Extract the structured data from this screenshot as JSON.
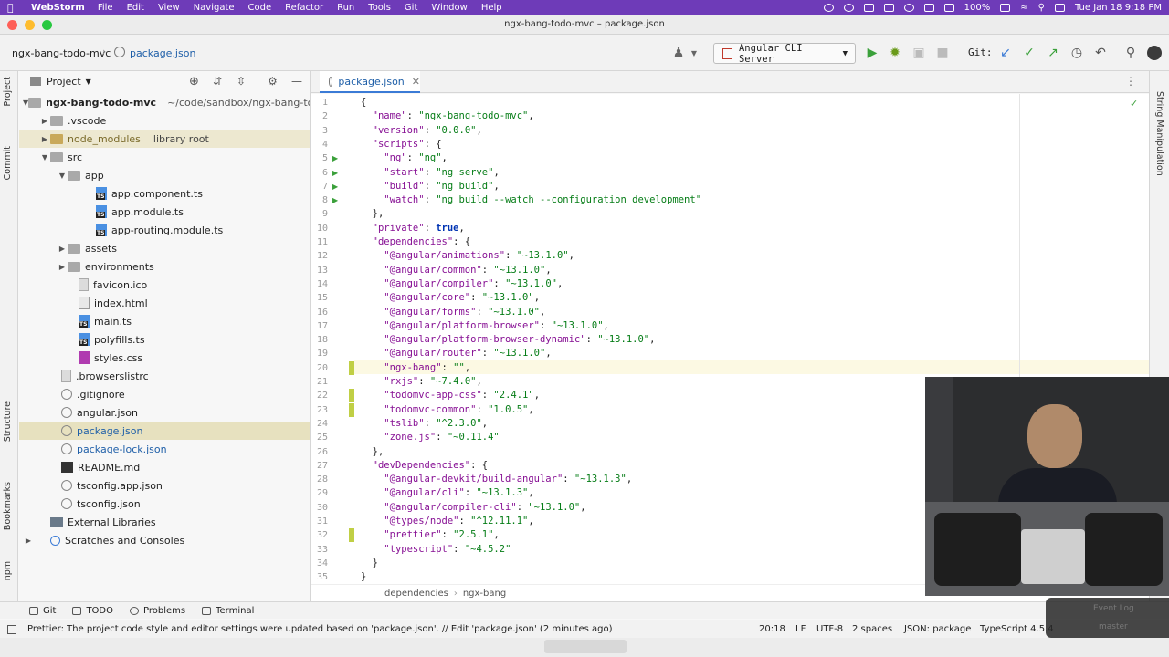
{
  "menubar": {
    "app": "WebStorm",
    "items": [
      "File",
      "Edit",
      "View",
      "Navigate",
      "Code",
      "Refactor",
      "Run",
      "Tools",
      "Git",
      "Window",
      "Help"
    ],
    "battery": "100%",
    "datetime": "Tue Jan 18  9:18 PM"
  },
  "window": {
    "title": "ngx-bang-todo-mvc – package.json"
  },
  "navbar": {
    "crumb_project": "ngx-bang-todo-mvc",
    "crumb_file": "package.json",
    "run_config": "Angular CLI Server",
    "git_label": "Git:"
  },
  "strip": {
    "project": "Project",
    "commit": "Commit",
    "structure": "Structure",
    "bookmarks": "Bookmarks",
    "npm": "npm",
    "string_manipulation": "String Manipulation"
  },
  "project_panel": {
    "title": "Project",
    "items": [
      {
        "label": "ngx-bang-todo-mvc",
        "extra": "~/code/sandbox/ngx-bang-todo"
      },
      {
        "label": ".vscode"
      },
      {
        "label": "node_modules",
        "extra": "library root"
      },
      {
        "label": "src"
      },
      {
        "label": "app"
      },
      {
        "label": "app.component.ts"
      },
      {
        "label": "app.module.ts"
      },
      {
        "label": "app-routing.module.ts"
      },
      {
        "label": "assets"
      },
      {
        "label": "environments"
      },
      {
        "label": "favicon.ico"
      },
      {
        "label": "index.html"
      },
      {
        "label": "main.ts"
      },
      {
        "label": "polyfills.ts"
      },
      {
        "label": "styles.css"
      },
      {
        "label": ".browserslistrc"
      },
      {
        "label": ".gitignore"
      },
      {
        "label": "angular.json"
      },
      {
        "label": "package.json"
      },
      {
        "label": "package-lock.json"
      },
      {
        "label": "README.md"
      },
      {
        "label": "tsconfig.app.json"
      },
      {
        "label": "tsconfig.json"
      },
      {
        "label": "External Libraries"
      },
      {
        "label": "Scratches and Consoles"
      }
    ]
  },
  "editor": {
    "tab": "package.json",
    "lines": [
      {
        "n": "1",
        "t": "{"
      },
      {
        "n": "2",
        "k": "\"name\"",
        "v": "\"ngx-bang-todo-mvc\"",
        "i": "  "
      },
      {
        "n": "3",
        "k": "\"version\"",
        "v": "\"0.0.0\"",
        "i": "  "
      },
      {
        "n": "4",
        "k": "\"scripts\"",
        "t2": ": {",
        "i": "  "
      },
      {
        "n": "5",
        "k": "\"ng\"",
        "v": "\"ng\"",
        "i": "    "
      },
      {
        "n": "6",
        "k": "\"start\"",
        "v": "\"ng serve\"",
        "i": "    "
      },
      {
        "n": "7",
        "k": "\"build\"",
        "v": "\"ng build\"",
        "i": "    "
      },
      {
        "n": "8",
        "k": "\"watch\"",
        "v": "\"ng build --watch --configuration development\"",
        "i": "    ",
        "last": true
      },
      {
        "n": "9",
        "t": "  },"
      },
      {
        "n": "10",
        "k": "\"private\"",
        "vb": "true",
        "i": "  "
      },
      {
        "n": "11",
        "k": "\"dependencies\"",
        "t2": ": {",
        "i": "  "
      },
      {
        "n": "12",
        "k": "\"@angular/animations\"",
        "v": "\"~13.1.0\"",
        "i": "    "
      },
      {
        "n": "13",
        "k": "\"@angular/common\"",
        "v": "\"~13.1.0\"",
        "i": "    "
      },
      {
        "n": "14",
        "k": "\"@angular/compiler\"",
        "v": "\"~13.1.0\"",
        "i": "    "
      },
      {
        "n": "15",
        "k": "\"@angular/core\"",
        "v": "\"~13.1.0\"",
        "i": "    "
      },
      {
        "n": "16",
        "k": "\"@angular/forms\"",
        "v": "\"~13.1.0\"",
        "i": "    "
      },
      {
        "n": "17",
        "k": "\"@angular/platform-browser\"",
        "v": "\"~13.1.0\"",
        "i": "    "
      },
      {
        "n": "18",
        "k": "\"@angular/platform-browser-dynamic\"",
        "v": "\"~13.1.0\"",
        "i": "    "
      },
      {
        "n": "19",
        "k": "\"@angular/router\"",
        "v": "\"~13.1.0\"",
        "i": "    "
      },
      {
        "n": "20",
        "k": "\"ngx-bang\"",
        "v": "\"\"",
        "i": "    "
      },
      {
        "n": "21",
        "k": "\"rxjs\"",
        "v": "\"~7.4.0\"",
        "i": "    "
      },
      {
        "n": "22",
        "k": "\"todomvc-app-css\"",
        "v": "\"2.4.1\"",
        "i": "    "
      },
      {
        "n": "23",
        "k": "\"todomvc-common\"",
        "v": "\"1.0.5\"",
        "i": "    "
      },
      {
        "n": "24",
        "k": "\"tslib\"",
        "v": "\"^2.3.0\"",
        "i": "    "
      },
      {
        "n": "25",
        "k": "\"zone.js\"",
        "v": "\"~0.11.4\"",
        "i": "    ",
        "last": true
      },
      {
        "n": "26",
        "t": "  },"
      },
      {
        "n": "27",
        "k": "\"devDependencies\"",
        "t2": ": {",
        "i": "  "
      },
      {
        "n": "28",
        "k": "\"@angular-devkit/build-angular\"",
        "v": "\"~13.1.3\"",
        "i": "    "
      },
      {
        "n": "29",
        "k": "\"@angular/cli\"",
        "v": "\"~13.1.3\"",
        "i": "    "
      },
      {
        "n": "30",
        "k": "\"@angular/compiler-cli\"",
        "v": "\"~13.1.0\"",
        "i": "    "
      },
      {
        "n": "31",
        "k": "\"@types/node\"",
        "v": "\"^12.11.1\"",
        "i": "    "
      },
      {
        "n": "32",
        "k": "\"prettier\"",
        "v": "\"2.5.1\"",
        "i": "    "
      },
      {
        "n": "33",
        "k": "\"typescript\"",
        "v": "\"~4.5.2\"",
        "i": "    ",
        "last": true
      },
      {
        "n": "34",
        "t": "  }"
      },
      {
        "n": "35",
        "t": "}"
      }
    ],
    "breadcrumb": [
      "dependencies",
      "ngx-bang"
    ]
  },
  "bottom_tabs": [
    "Git",
    "TODO",
    "Problems",
    "Terminal"
  ],
  "status": {
    "message": "Prettier: The project code style and editor settings were updated based on 'package.json'. // Edit 'package.json' (2 minutes ago)",
    "position": "20:18",
    "line_sep": "LF",
    "encoding": "UTF-8",
    "indent": "2 spaces",
    "schema": "JSON: package",
    "lang": "TypeScript 4.5.4"
  },
  "overlay": {
    "event_log": "Event Log",
    "branch": "master"
  }
}
